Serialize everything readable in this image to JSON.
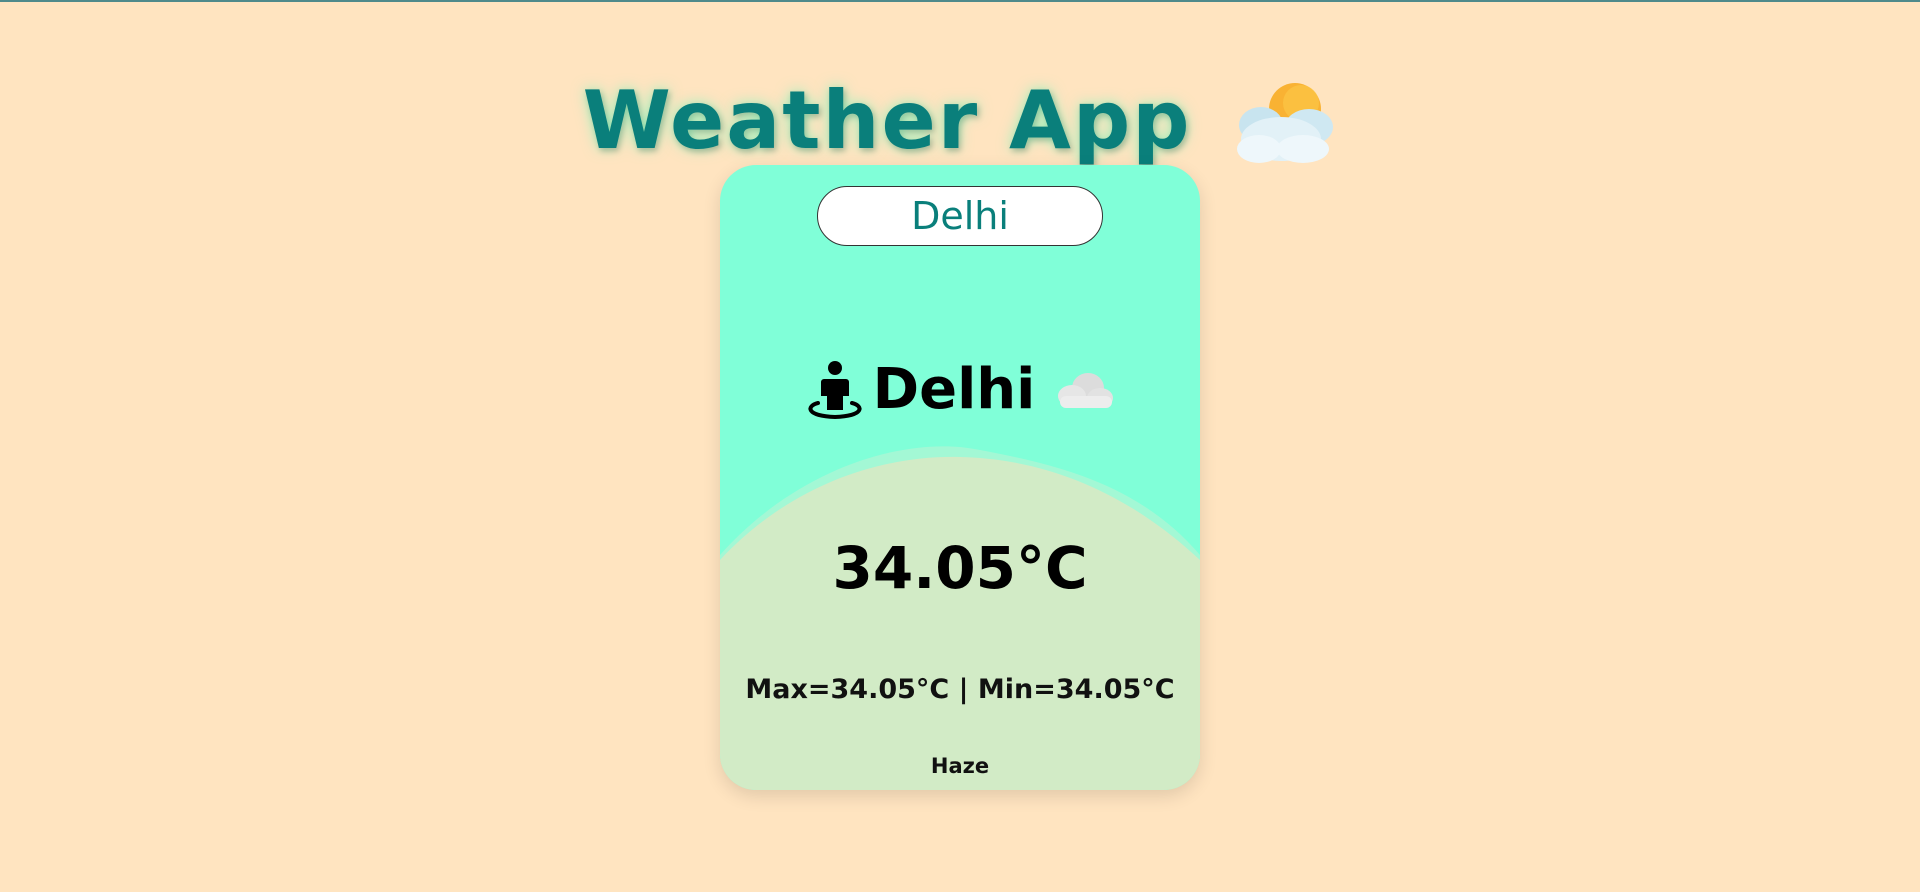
{
  "app": {
    "title": "Weather App",
    "title_icon": "sun-behind-cloud-icon"
  },
  "search": {
    "value": "Delhi"
  },
  "weather": {
    "location_icon": "person-location-pin-icon",
    "city": "Delhi",
    "condition_icon": "cloud-icon",
    "temperature": "34.05°C",
    "minmax": "Max=34.05°C | Min=34.05°C",
    "condition": "Haze"
  },
  "colors": {
    "background": "#ffe4c0",
    "title": "#0a7f7b",
    "card_top": "#80ffd8",
    "card_bottom": "#d2ebc6",
    "input_text": "#0a7f7b"
  }
}
